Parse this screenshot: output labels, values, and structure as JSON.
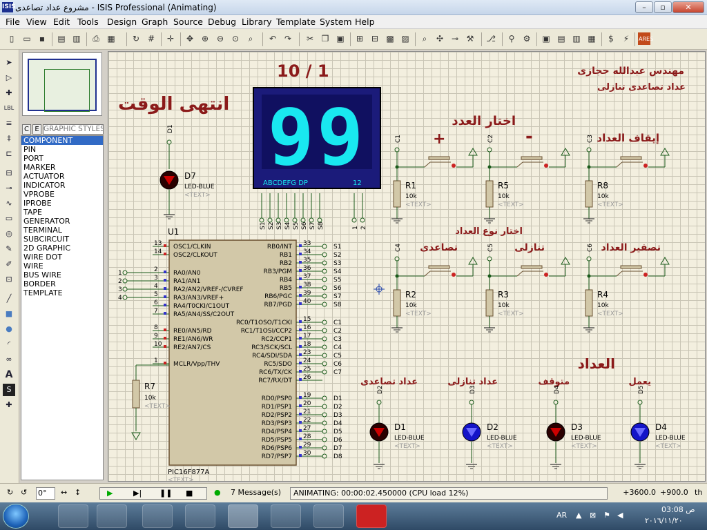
{
  "window": {
    "title": "مشروع عداد تصاعدى - ISIS Professional (Animating)",
    "app_icon": "ISIS"
  },
  "menu": [
    "File",
    "View",
    "Edit",
    "Tools",
    "Design",
    "Graph",
    "Source",
    "Debug",
    "Library",
    "Template",
    "System",
    "Help"
  ],
  "selector": {
    "c_label": "C",
    "e_label": "E",
    "panel_title": "GRAPHIC STYLES",
    "items": [
      "COMPONENT",
      "PIN",
      "PORT",
      "MARKER",
      "ACTUATOR",
      "INDICATOR",
      "VPROBE",
      "IPROBE",
      "TAPE",
      "GENERATOR",
      "TERMINAL",
      "SUBCIRCUIT",
      "2D GRAPHIC",
      "WIRE DOT",
      "WIRE",
      "BUS WIRE",
      "BORDER",
      "TEMPLATE"
    ],
    "selected": "COMPONENT"
  },
  "schematic": {
    "header_date": "10  /  1",
    "engineer": "مهندس عبدالله حجازى",
    "project": "عداد تصاعدى تنازلى",
    "time_over": "انتهى الوقت",
    "choose_number": "اختار العدد",
    "plus_sign": "+",
    "minus_sign": "-",
    "stop_counter": "إيقاف العداد",
    "choose_type": "اختار نوع العداد",
    "ascending": "تصاعدى",
    "descending": "تنازلى",
    "reset_counter": "تصفير العداد",
    "counter_title": "العداد",
    "asc_counter": "عداد تصاعدى",
    "desc_counter": "عداد تنازلى",
    "stopped": "متوقف",
    "working": "يعمل",
    "display_value": "99",
    "display_pins": "ABCDEFG  DP",
    "display_pins2": "12",
    "mcu_ref": "U1",
    "mcu_part": "PIC16F877A",
    "text_placeholder": "<TEXT>",
    "led_type": "LED-BLUE",
    "res_value": "10k",
    "d7": "D7",
    "d7_net": "D1",
    "r1": "R1",
    "r5": "R5",
    "r8": "R8",
    "r2": "R2",
    "r3": "R3",
    "r4": "R4",
    "r7": "R7",
    "leds": [
      {
        "ref": "D1",
        "net": "D2"
      },
      {
        "ref": "D2",
        "net": "D3"
      },
      {
        "ref": "D3",
        "net": "D4"
      },
      {
        "ref": "D4",
        "net": "D5"
      }
    ],
    "button_nets": [
      "C1",
      "C2",
      "C3",
      "C4",
      "C5",
      "C6"
    ],
    "disp_nets": [
      "S1",
      "S2",
      "S3",
      "S4",
      "S5",
      "S6",
      "S7",
      "S8",
      "1",
      "2"
    ],
    "mcu_left": [
      {
        "n": "13",
        "l": "OSC1/CLKIN"
      },
      {
        "n": "14",
        "l": "OSC2/CLKOUT"
      },
      {
        "n": "2",
        "l": "RA0/AN0"
      },
      {
        "n": "3",
        "l": "RA1/AN1"
      },
      {
        "n": "4",
        "l": "RA2/AN2/VREF-/CVREF"
      },
      {
        "n": "5",
        "l": "RA3/AN3/VREF+"
      },
      {
        "n": "6",
        "l": "RA4/T0CKI/C1OUT"
      },
      {
        "n": "7",
        "l": "RA5/AN4/SS/C2OUT"
      },
      {
        "n": "8",
        "l": "RE0/AN5/RD"
      },
      {
        "n": "9",
        "l": "RE1/AN6/WR"
      },
      {
        "n": "10",
        "l": "RE2/AN7/CS"
      },
      {
        "n": "1",
        "l": "MCLR/Vpp/THV"
      }
    ],
    "mcu_left_nets": [
      "1",
      "2",
      "3",
      "4"
    ],
    "mcu_right": [
      {
        "n": "33",
        "l": "RB0/INT",
        "net": "S1"
      },
      {
        "n": "34",
        "l": "RB1",
        "net": "S2"
      },
      {
        "n": "35",
        "l": "RB2",
        "net": "S3"
      },
      {
        "n": "36",
        "l": "RB3/PGM",
        "net": "S4"
      },
      {
        "n": "37",
        "l": "RB4",
        "net": "S5"
      },
      {
        "n": "38",
        "l": "RB5",
        "net": "S6"
      },
      {
        "n": "39",
        "l": "RB6/PGC",
        "net": "S7"
      },
      {
        "n": "40",
        "l": "RB7/PGD",
        "net": "S8"
      },
      {
        "n": "15",
        "l": "RC0/T1OSO/T1CKI",
        "net": "C1"
      },
      {
        "n": "16",
        "l": "RC1/T1OSI/CCP2",
        "net": "C2"
      },
      {
        "n": "17",
        "l": "RC2/CCP1",
        "net": "C3"
      },
      {
        "n": "18",
        "l": "RC3/SCK/SCL",
        "net": "C4"
      },
      {
        "n": "23",
        "l": "RC4/SDI/SDA",
        "net": "C5"
      },
      {
        "n": "24",
        "l": "RC5/SDO",
        "net": "C6"
      },
      {
        "n": "25",
        "l": "RC6/TX/CK",
        "net": "C7"
      },
      {
        "n": "26",
        "l": "RC7/RX/DT",
        "net": ""
      },
      {
        "n": "19",
        "l": "RD0/PSP0",
        "net": "D1"
      },
      {
        "n": "20",
        "l": "RD1/PSP1",
        "net": "D2"
      },
      {
        "n": "21",
        "l": "RD2/PSP2",
        "net": "D3"
      },
      {
        "n": "22",
        "l": "RD3/PSP3",
        "net": "D4"
      },
      {
        "n": "27",
        "l": "RD4/PSP4",
        "net": "D5"
      },
      {
        "n": "28",
        "l": "RD5/PSP5",
        "net": "D6"
      },
      {
        "n": "29",
        "l": "RD6/PSP6",
        "net": "D7"
      },
      {
        "n": "30",
        "l": "RD7/PSP7",
        "net": "D8"
      }
    ]
  },
  "status": {
    "rotation": "0°",
    "messages": "7 Message(s)",
    "animating": "ANIMATING: 00:00:02.450000 (CPU load 12%)",
    "x": "+3600.0",
    "y": "+900.0",
    "unit": "th"
  },
  "taskbar": {
    "lang": "AR",
    "time": "03:08 ص",
    "date": "٢٠١٦/١١/٢٠"
  },
  "colors": {
    "grid_bg": "#f3efdf",
    "wire": "#1a5a1a",
    "title_red": "#8b1a1a",
    "display_bg": "#1b1b7a",
    "segment": "#19e8f0",
    "led_blue": "#1414c8"
  }
}
